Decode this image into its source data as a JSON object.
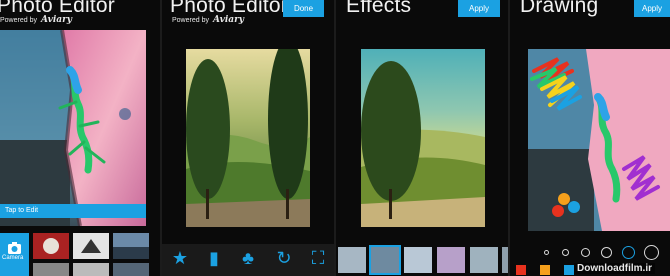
{
  "screens": [
    {
      "title": "Photo Editor",
      "powered_label": "Powered by",
      "brand": "Aviary",
      "tap_label": "Tap to Edit",
      "camera_label": "Camera"
    },
    {
      "title": "Photo Editor",
      "powered_label": "Powered by",
      "brand": "Aviary",
      "done_label": "Done"
    },
    {
      "title": "Effects",
      "apply_label": "Apply"
    },
    {
      "title": "Drawing",
      "apply_label": "Apply"
    }
  ],
  "watermark": "Downloadfilm.ir",
  "colors": {
    "accent": "#1ba1e2",
    "background": "#0a0a0a",
    "swatches": [
      "#e8321e",
      "#f5a01c",
      "#1ba1e2"
    ]
  },
  "icons": {
    "toolbar": [
      "star-icon",
      "enhance-icon",
      "effects-icon",
      "rotate-icon",
      "crop-icon"
    ]
  }
}
